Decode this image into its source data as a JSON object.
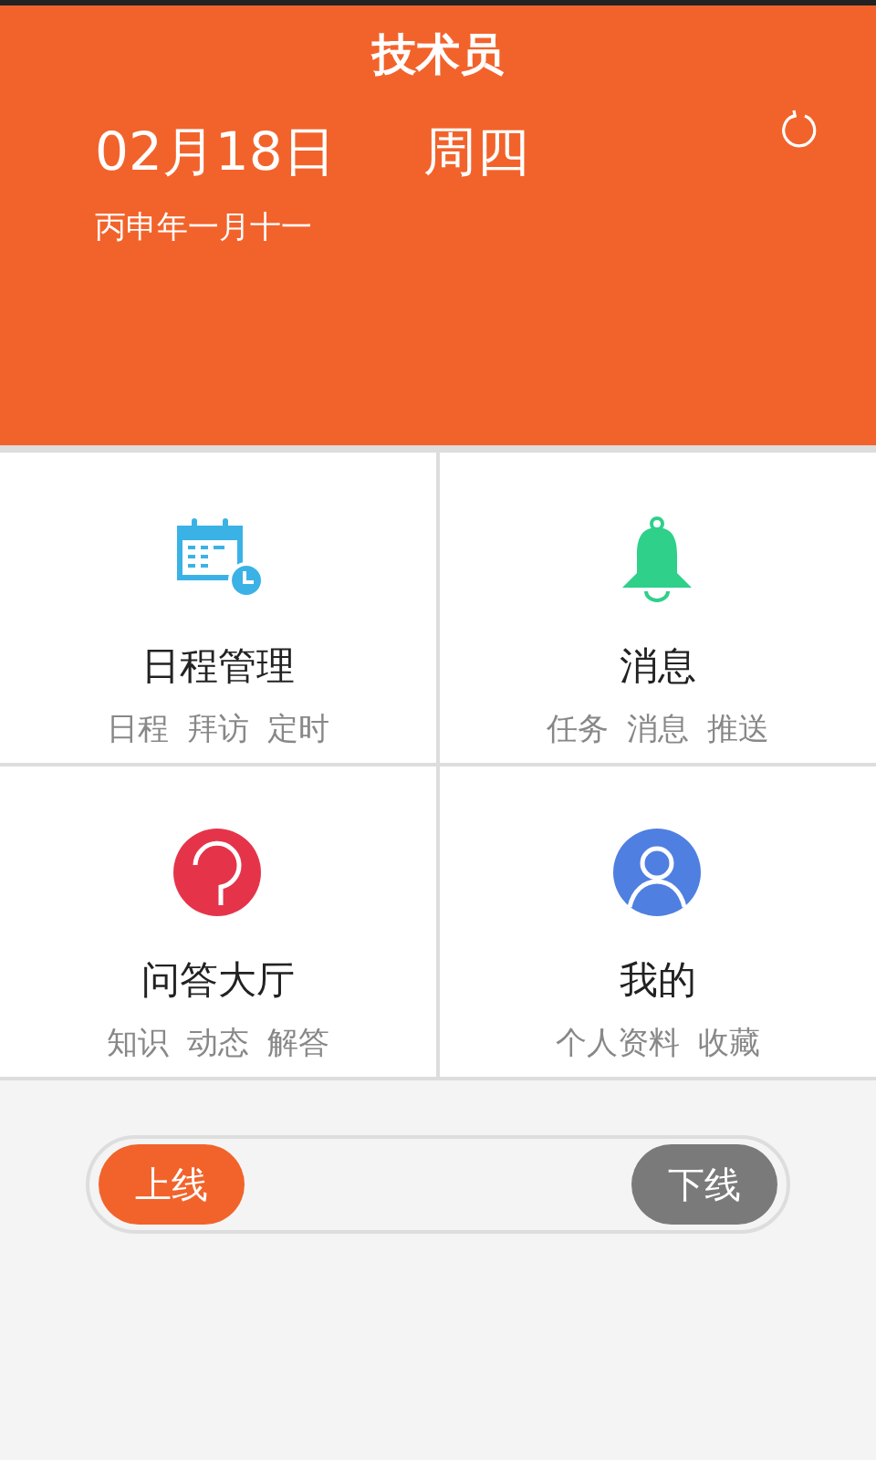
{
  "header": {
    "title": "技术员",
    "date": "02月18日",
    "weekday": "周四",
    "lunar": "丙申年一月十一"
  },
  "tiles": [
    {
      "kind": "calendar",
      "title": "日程管理",
      "links": [
        "日程",
        "拜访",
        "定时"
      ]
    },
    {
      "kind": "bell",
      "title": "消息",
      "links": [
        "任务",
        "消息",
        "推送"
      ]
    },
    {
      "kind": "question",
      "title": "问答大厅",
      "links": [
        "知识",
        "动态",
        "解答"
      ]
    },
    {
      "kind": "user",
      "title": "我的",
      "links": [
        "个人资料",
        "收藏"
      ]
    }
  ],
  "status_switch": [
    {
      "label": "上线",
      "selected": true
    },
    {
      "label": "下线",
      "selected": false
    }
  ]
}
